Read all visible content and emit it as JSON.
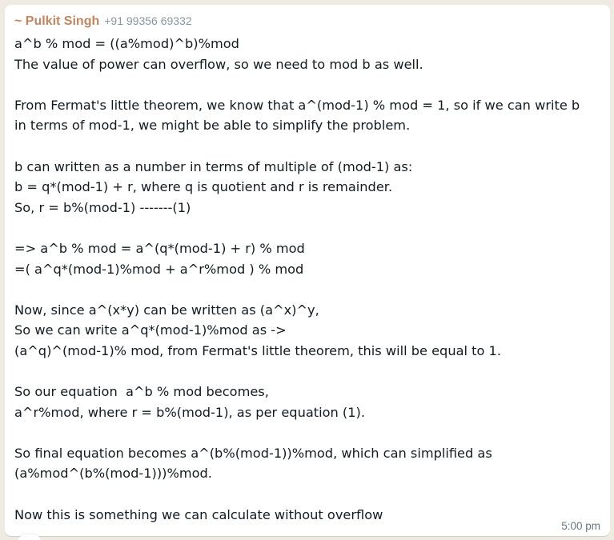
{
  "message": {
    "sender_name": "~ Pulkit Singh",
    "sender_phone": "+91 99356 69332",
    "lines": [
      "a^b % mod = ((a%mod)^b)%mod",
      "The value of power can overflow, so we need to mod b as well.",
      "",
      "From Fermat's little theorem, we know that a^(mod-1) % mod = 1, so if we can write b",
      "in terms of mod-1, we might be able to simplify the problem.",
      "",
      "b can written as a number in terms of multiple of (mod-1) as:",
      "b = q*(mod-1) + r, where q is quotient and r is remainder.",
      "So, r = b%(mod-1) -------(1)",
      "",
      "=> a^b % mod = a^(q*(mod-1) + r) % mod",
      "=( a^q*(mod-1)%mod + a^r%mod ) % mod",
      "",
      "Now, since a^(x*y) can be written as (a^x)^y,",
      "So we can write a^q*(mod-1)%mod as ->",
      "(a^q)^(mod-1)% mod, from Fermat's little theorem, this will be equal to 1.",
      "",
      "So our equation  a^b % mod becomes,",
      "a^r%mod, where r = b%(mod-1), as per equation (1).",
      "",
      "So final equation becomes a^(b%(mod-1))%mod, which can simplified as",
      "(a%mod^(b%(mod-1)))%mod.",
      "",
      "Now this is something we can calculate without overflow"
    ],
    "timestamp": "5:00 pm"
  }
}
